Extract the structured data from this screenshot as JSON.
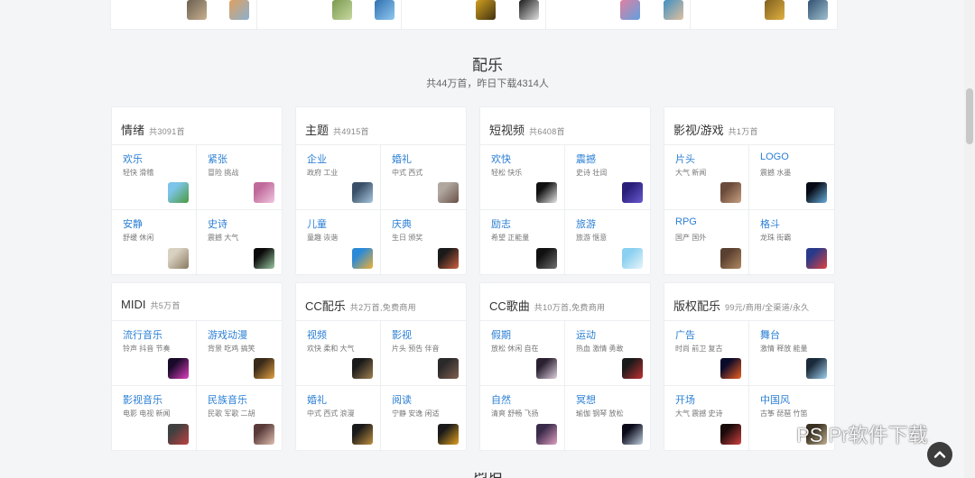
{
  "section": {
    "title": "配乐",
    "subtitle": "共44万首，昨日下载4314人"
  },
  "next_section_title": "词语",
  "cards": [
    {
      "title": "情绪",
      "count": "共3091首",
      "items": [
        {
          "name": "欢乐",
          "tags": "轻快 滑稽",
          "thumb": [
            "#7cc4e8",
            "#4c9a3c"
          ]
        },
        {
          "name": "紧张",
          "tags": "冒险 挑战",
          "thumb": [
            "#c06a9c",
            "#f0c8e0"
          ]
        },
        {
          "name": "安静",
          "tags": "舒缓 休闲",
          "thumb": [
            "#d8d0c0",
            "#8a7a60"
          ]
        },
        {
          "name": "史诗",
          "tags": "震撼 大气",
          "thumb": [
            "#0a0a0a",
            "#9ac8a0"
          ]
        }
      ]
    },
    {
      "title": "主题",
      "count": "共4915首",
      "items": [
        {
          "name": "企业",
          "tags": "政府 工业",
          "thumb": [
            "#3a5068",
            "#a8c8e0"
          ]
        },
        {
          "name": "婚礼",
          "tags": "中式 西式",
          "thumb": [
            "#b0a8a0",
            "#6a5048"
          ]
        },
        {
          "name": "儿童",
          "tags": "童趣 诙谐",
          "thumb": [
            "#2a8ad8",
            "#f0b030"
          ]
        },
        {
          "name": "庆典",
          "tags": "生日 颁奖",
          "thumb": [
            "#1a1a1a",
            "#d06040"
          ]
        }
      ]
    },
    {
      "title": "短视频",
      "count": "共6408首",
      "items": [
        {
          "name": "欢快",
          "tags": "轻松 快乐",
          "thumb": [
            "#101010",
            "#e8e8e8"
          ]
        },
        {
          "name": "震撼",
          "tags": "史诗 壮阔",
          "thumb": [
            "#2a1e7a",
            "#6a5ad0"
          ]
        },
        {
          "name": "励志",
          "tags": "希望 正能量",
          "thumb": [
            "#101010",
            "#707070"
          ]
        },
        {
          "name": "旅游",
          "tags": "旅游 惬意",
          "thumb": [
            "#8ad0f0",
            "#e8f4fa"
          ]
        }
      ]
    },
    {
      "title": "影视/游戏",
      "count": "共1万首",
      "items": [
        {
          "name": "片头",
          "tags": "大气 新闻",
          "thumb": [
            "#6a4a3a",
            "#c8a080"
          ]
        },
        {
          "name": "LOGO",
          "tags": "震撼 水墨",
          "thumb": [
            "#050a14",
            "#6ab0e0"
          ]
        },
        {
          "name": "RPG",
          "tags": "国产 国外",
          "thumb": [
            "#5a4030",
            "#b08860"
          ]
        },
        {
          "name": "格斗",
          "tags": "龙珠 街霸",
          "thumb": [
            "#2a3a8a",
            "#e04040"
          ]
        }
      ]
    },
    {
      "title": "MIDI",
      "count": "共5万首",
      "items": [
        {
          "name": "流行音乐",
          "tags": "铃声 抖音 节奏",
          "thumb": [
            "#1a0a2a",
            "#e040c0"
          ]
        },
        {
          "name": "游戏动漫",
          "tags": "背景 吃鸡 搞笑",
          "thumb": [
            "#3a2a1a",
            "#e0a040"
          ]
        },
        {
          "name": "影视音乐",
          "tags": "电影 电视 新闻",
          "thumb": [
            "#404040",
            "#c04040"
          ]
        },
        {
          "name": "民族音乐",
          "tags": "民歌 军歌 二胡",
          "thumb": [
            "#5a3a3a",
            "#e0c0b0"
          ]
        }
      ]
    },
    {
      "title": "CC配乐",
      "count": "共2万首,免费商用",
      "items": [
        {
          "name": "视频",
          "tags": "欢快 柔和 大气",
          "thumb": [
            "#1a1a1a",
            "#a08050"
          ]
        },
        {
          "name": "影视",
          "tags": "片头 预告 伴音",
          "thumb": [
            "#2a2a2a",
            "#806050"
          ]
        },
        {
          "name": "婚礼",
          "tags": "中式 西式 浪漫",
          "thumb": [
            "#1a1a1a",
            "#c09040"
          ]
        },
        {
          "name": "阅读",
          "tags": "宁静 安逸 闲适",
          "thumb": [
            "#1a1a1a",
            "#e0a020"
          ]
        }
      ]
    },
    {
      "title": "CC歌曲",
      "count": "共10万首,免费商用",
      "items": [
        {
          "name": "假期",
          "tags": "放松 休闲 自在",
          "thumb": [
            "#2a2030",
            "#e0d0e0"
          ]
        },
        {
          "name": "运动",
          "tags": "热血 激情 勇敢",
          "thumb": [
            "#1a1a1a",
            "#c03030"
          ]
        },
        {
          "name": "自然",
          "tags": "清爽 舒畅 飞扬",
          "thumb": [
            "#3a2a4a",
            "#e0a0c0"
          ]
        },
        {
          "name": "冥想",
          "tags": "瑜伽 钢琴 放松",
          "thumb": [
            "#0a0a1a",
            "#c0d0e0"
          ]
        }
      ]
    },
    {
      "title": "版权配乐",
      "count": "99元/商用/全渠道/永久",
      "items": [
        {
          "name": "广告",
          "tags": "时尚 前卫 复古",
          "thumb": [
            "#0a0a2a",
            "#f06020"
          ]
        },
        {
          "name": "舞台",
          "tags": "激情 释放 能量",
          "thumb": [
            "#1a2a3a",
            "#a0d0f0"
          ]
        },
        {
          "name": "开场",
          "tags": "大气 震撼 史诗",
          "thumb": [
            "#1a0a0a",
            "#d04040"
          ]
        },
        {
          "name": "中国风",
          "tags": "古筝 琵琶 竹笛",
          "thumb": [
            "#3a3020",
            "#c0b090"
          ]
        }
      ]
    }
  ],
  "top_thumbs": [
    [
      "#6a6050",
      "#c8b090"
    ],
    [
      "#e0a060",
      "#8ab0d0"
    ],
    [
      "#7a9a50",
      "#c8d8a0"
    ],
    [
      "#3070b0",
      "#90c8f0"
    ],
    [
      "#d0a020",
      "#403010"
    ],
    [
      "#1a1a1a",
      "#e0e0e0"
    ],
    [
      "#e080a0",
      "#60a0e0"
    ],
    [
      "#4090c0",
      "#e0c0a0"
    ],
    [
      "#806020",
      "#e0b040"
    ],
    [
      "#305070",
      "#a0c0d0"
    ]
  ],
  "watermark": {
    "text": "PS Pr软件下载"
  },
  "back_to_top_icon": "chevron-up-icon"
}
